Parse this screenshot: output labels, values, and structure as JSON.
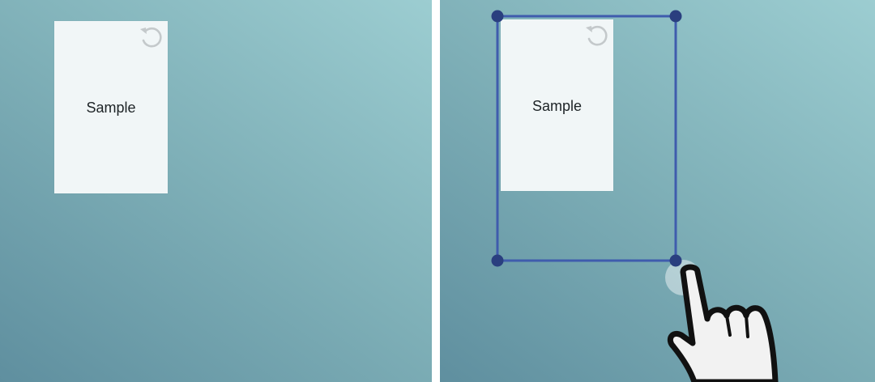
{
  "left_panel": {
    "card": {
      "label": "Sample",
      "rotate_icon": "rotate-ccw-icon"
    }
  },
  "right_panel": {
    "card": {
      "label": "Sample",
      "rotate_icon": "rotate-ccw-icon"
    },
    "selection": {
      "handles": [
        "top-left-handle",
        "top-right-handle",
        "bottom-left-handle",
        "bottom-right-handle"
      ],
      "active_handle": "bottom-right-handle",
      "gesture_icon": "pointing-hand-icon"
    }
  },
  "colors": {
    "background_dark": "#5f8f9f",
    "background_light": "#9ccdd1",
    "card": "#f1f6f7",
    "selection_line": "#3f5cad",
    "handle": "#2a3f7f"
  }
}
